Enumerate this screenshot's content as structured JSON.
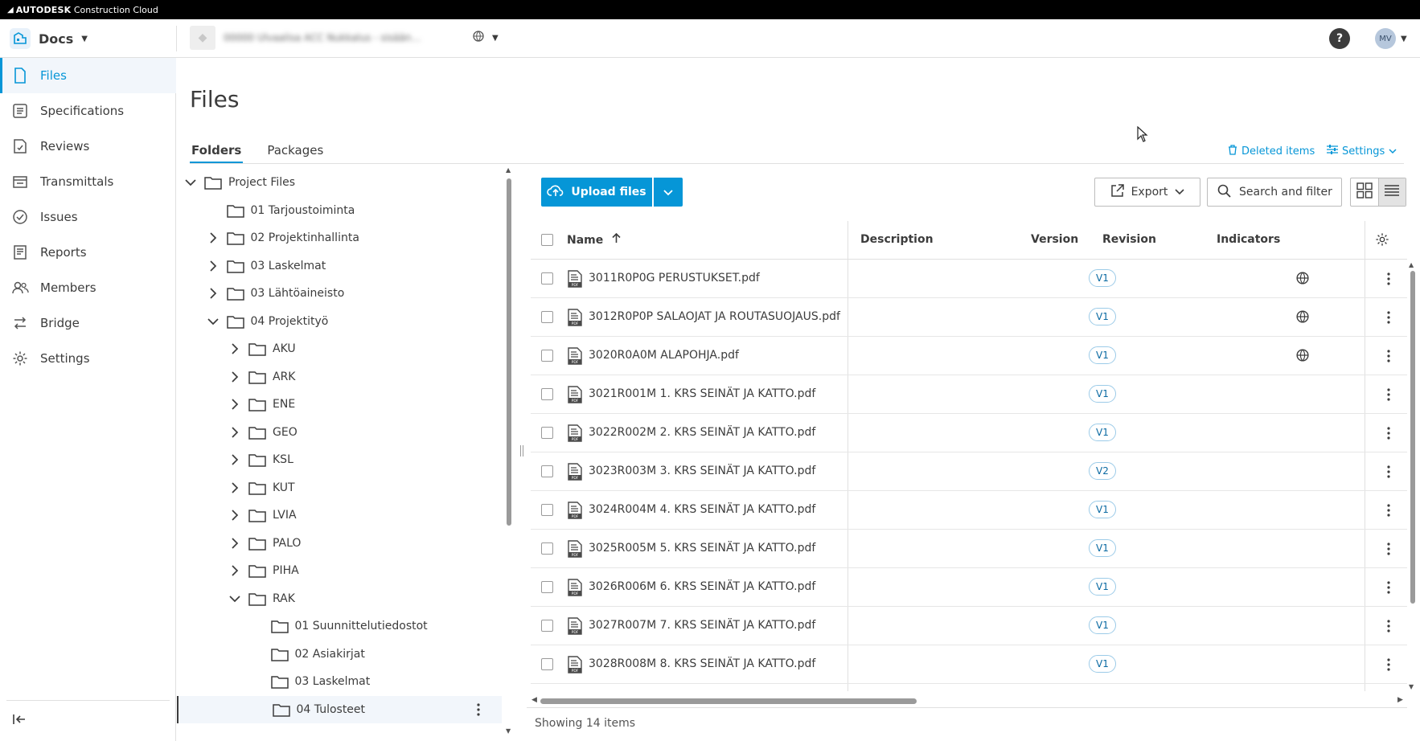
{
  "app": {
    "brand": "AUTODESK",
    "product": "Construction Cloud"
  },
  "header": {
    "module_label": "Docs",
    "project_name": "00000 Ulvaalisa ACC Nukkalus - sisään…",
    "help_label": "?",
    "user_initials": "MV"
  },
  "sidebar": {
    "items": [
      {
        "label": "Files",
        "icon": "file-icon",
        "active": true
      },
      {
        "label": "Specifications",
        "icon": "specifications-icon"
      },
      {
        "label": "Reviews",
        "icon": "reviews-icon"
      },
      {
        "label": "Transmittals",
        "icon": "transmittals-icon"
      },
      {
        "label": "Issues",
        "icon": "issues-icon"
      },
      {
        "label": "Reports",
        "icon": "reports-icon"
      },
      {
        "label": "Members",
        "icon": "members-icon"
      },
      {
        "label": "Bridge",
        "icon": "bridge-icon"
      },
      {
        "label": "Settings",
        "icon": "gear-icon"
      }
    ]
  },
  "page": {
    "title": "Files",
    "tabs": [
      {
        "label": "Folders",
        "active": true
      },
      {
        "label": "Packages"
      }
    ],
    "deleted_items_label": "Deleted items",
    "settings_label": "Settings"
  },
  "folder_tree": [
    {
      "label": "Project Files",
      "level": 0,
      "state": "expanded"
    },
    {
      "label": "01 Tarjoustoiminta",
      "level": 1,
      "state": "leaf"
    },
    {
      "label": "02 Projektinhallinta",
      "level": 1,
      "state": "collapsed"
    },
    {
      "label": "03 Laskelmat",
      "level": 1,
      "state": "collapsed"
    },
    {
      "label": "03 Lähtöaineisto",
      "level": 1,
      "state": "collapsed"
    },
    {
      "label": "04 Projektityö",
      "level": 1,
      "state": "expanded"
    },
    {
      "label": "AKU",
      "level": 2,
      "state": "collapsed"
    },
    {
      "label": "ARK",
      "level": 2,
      "state": "collapsed"
    },
    {
      "label": "ENE",
      "level": 2,
      "state": "collapsed"
    },
    {
      "label": "GEO",
      "level": 2,
      "state": "collapsed"
    },
    {
      "label": "KSL",
      "level": 2,
      "state": "collapsed"
    },
    {
      "label": "KUT",
      "level": 2,
      "state": "collapsed"
    },
    {
      "label": "LVIA",
      "level": 2,
      "state": "collapsed"
    },
    {
      "label": "PALO",
      "level": 2,
      "state": "collapsed"
    },
    {
      "label": "PIHA",
      "level": 2,
      "state": "collapsed"
    },
    {
      "label": "RAK",
      "level": 2,
      "state": "expanded"
    },
    {
      "label": "01 Suunnittelutiedostot",
      "level": 3,
      "state": "leaf"
    },
    {
      "label": "02 Asiakirjat",
      "level": 3,
      "state": "leaf"
    },
    {
      "label": "03 Laskelmat",
      "level": 3,
      "state": "leaf"
    },
    {
      "label": "04 Tulosteet",
      "level": 3,
      "state": "leaf",
      "selected": true
    }
  ],
  "toolbar": {
    "upload_label": "Upload files",
    "export_label": "Export",
    "search_label": "Search and filter"
  },
  "table": {
    "columns": {
      "name": "Name",
      "description": "Description",
      "version": "Version",
      "revision": "Revision",
      "indicators": "Indicators"
    },
    "rows": [
      {
        "name": "3011R0P0G PERUSTUKSET.pdf",
        "version": "V1",
        "indicator": "globe-icon"
      },
      {
        "name": "3012R0P0P SALAOJAT JA ROUTASUOJAUS.pdf",
        "version": "V1",
        "indicator": "globe-icon"
      },
      {
        "name": "3020R0A0M ALAPOHJA.pdf",
        "version": "V1",
        "indicator": "globe-icon"
      },
      {
        "name": "3021R001M 1. KRS SEINÄT JA KATTO.pdf",
        "version": "V1"
      },
      {
        "name": "3022R002M 2. KRS SEINÄT JA KATTO.pdf",
        "version": "V1"
      },
      {
        "name": "3023R003M 3. KRS SEINÄT JA KATTO.pdf",
        "version": "V2"
      },
      {
        "name": "3024R004M 4. KRS SEINÄT JA KATTO.pdf",
        "version": "V1"
      },
      {
        "name": "3025R005M 5. KRS SEINÄT JA KATTO.pdf",
        "version": "V1"
      },
      {
        "name": "3026R006M 6. KRS SEINÄT JA KATTO.pdf",
        "version": "V1"
      },
      {
        "name": "3027R007M 7. KRS SEINÄT JA KATTO.pdf",
        "version": "V1"
      },
      {
        "name": "3028R008M 8. KRS SEINÄT JA KATTO.pdf",
        "version": "V1"
      }
    ],
    "footer": "Showing 14 items"
  },
  "colors": {
    "accent": "#0696d7",
    "topbar": "#000000",
    "badge_border": "#9ccbe8"
  }
}
